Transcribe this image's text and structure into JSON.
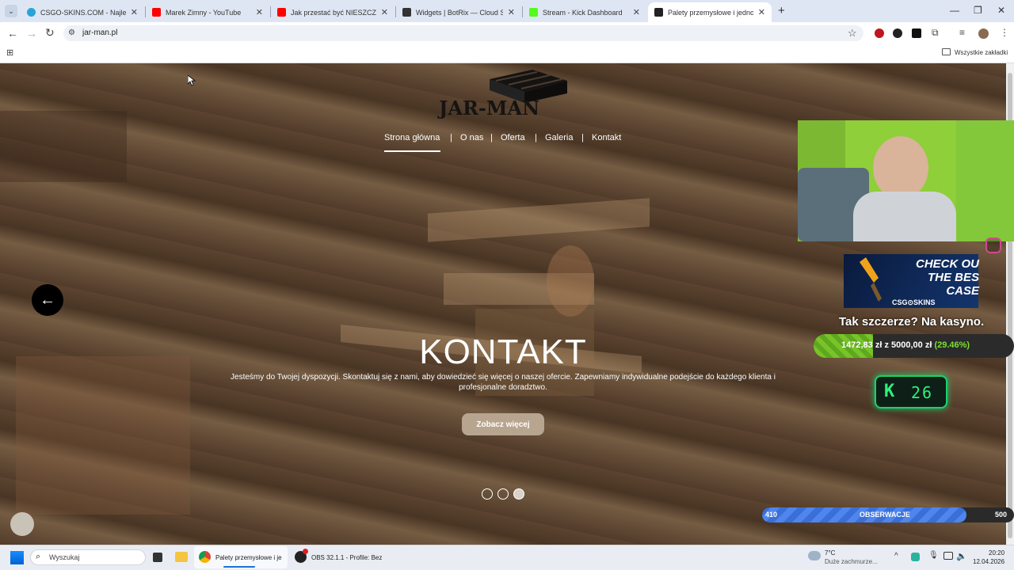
{
  "tabs": [
    {
      "title": "CSGO-SKINS.COM - Najlepsze",
      "favicon_color": "#2aa3d6"
    },
    {
      "title": "Marek Zimny - YouTube",
      "favicon_color": "#ff0000"
    },
    {
      "title": "Jak przestać być NIESZCZĘŚLIW",
      "favicon_color": "#ff0000"
    },
    {
      "title": "Widgets | BotRix — Cloud Strea",
      "favicon_color": "#333333"
    },
    {
      "title": "Stream - Kick Dashboard",
      "favicon_color": "#53fc18"
    },
    {
      "title": "Palety przemysłowe i jednoraz",
      "favicon_color": "#222222"
    }
  ],
  "toolbar": {
    "url": "jar-man.pl",
    "bookmarks_label": "Wszystkie zakładki"
  },
  "site": {
    "logo": "JAR-MAN",
    "menu": [
      "Strona główna",
      "O nas",
      "Oferta",
      "Galeria",
      "Kontakt"
    ],
    "menu_separator": "|",
    "hero_title": "KONTAKT",
    "hero_text": "Jesteśmy do Twojej dyspozycji. Skontaktuj się z nami, aby dowiedzieć się więcej o naszej ofercie. Zapewniamy indywidualne podejście do każdego klienta i profesjonalne doradztwo.",
    "hero_button": "Zobacz więcej",
    "prev_arrow": "←",
    "slides": 3,
    "active_slide": 3
  },
  "overlay": {
    "csg_headline": "CHECK OU THE BES CASE",
    "csg_brand": "CSG⊙SKINS",
    "casino_text": "Tak szczerze? Na kasyno.",
    "goal_current": "1472,83 zł",
    "goal_mid": "z",
    "goal_target": "5000,00 zł",
    "goal_percent": "(29.46%)",
    "goal_fraction": 0.2946,
    "kick_letter": "K",
    "kick_count": "26",
    "follow_min": "410",
    "follow_label": "OBSERWACJE",
    "follow_max": "500",
    "follow_fraction": 0.81
  },
  "taskbar": {
    "search_placeholder": "Wyszukaj",
    "app1": "Palety przemysłowe i je",
    "app2": "OBS 32.1.1 - Profile: Bez",
    "weather_temp": "7°C",
    "weather_desc": "Duże zachmurze...",
    "time": "20:20",
    "date": "12.04.2026"
  },
  "colors": {
    "accent_goal": "#78c32a",
    "kick_green": "#2ff07a",
    "follow_blue": "#3a6fd8"
  }
}
